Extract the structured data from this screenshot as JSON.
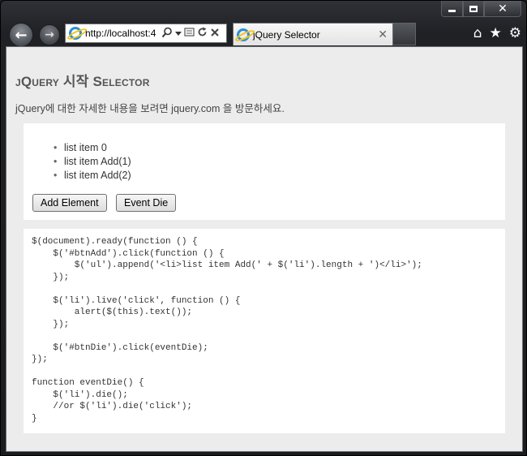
{
  "browser": {
    "url": "http://localhost:4",
    "tab_title": "jQuery Selector",
    "tab_close": "✕",
    "back_glyph": "←",
    "forward_glyph": "→",
    "caption": {
      "close_glyph": "✕"
    },
    "icons": {
      "home": "⌂",
      "favorites": "★",
      "tools": "⚙"
    }
  },
  "page": {
    "title": "jQuery 시작 Selector",
    "intro": "jQuery에 대한 자세한 내용을 보려면 jquery.com 을 방문하세요.",
    "list_items": [
      "list item 0",
      "list item Add(1)",
      "list item Add(2)"
    ],
    "buttons": {
      "add": "Add Element",
      "die": "Event Die"
    },
    "code_lines": [
      "$(document).ready(function () {",
      "    $('#btnAdd').click(function () {",
      "        $('ul').append('<li>list item Add(' + $('li').length + ')</li>');",
      "    });",
      "",
      "    $('li').live('click', function () {",
      "        alert($(this).text());",
      "    });",
      "",
      "    $('#btnDie').click(eventDie);",
      "});",
      "",
      "function eventDie() {",
      "    $('li').die();",
      "    //or $('li').die('click');",
      "}"
    ]
  }
}
